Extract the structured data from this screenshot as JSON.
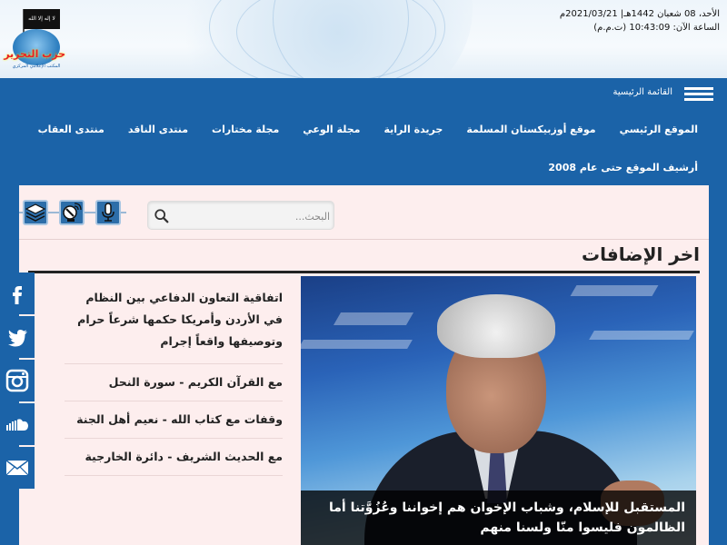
{
  "header": {
    "logo_text": "حزب التحرير",
    "logo_subtext": "المكتب الإعلامي المركزي",
    "logo_flag_text": "لا إله إلا الله محمد رسول الله",
    "date_line": "الأحد، 08 شعبان 1442هـ| 2021/03/21م",
    "time_line": "الساعة الآن: 10:43:09 (ت.م.م)"
  },
  "topbar": {
    "menu_label": "القائمة الرئيسية"
  },
  "nav": {
    "row1": [
      "الموقع الرئيسي",
      "موقع أوزبيكستان المسلمة",
      "جريدة الراية",
      "مجلة الوعي",
      "مجلة مختارات",
      "منتدى الناقد",
      "منتدى العقاب"
    ],
    "row2": [
      "أرشيف الموقع حتى عام 2008"
    ]
  },
  "search": {
    "placeholder": "البحث..."
  },
  "section": {
    "title": "اخر الإضافات"
  },
  "feature": {
    "caption": "المستقبل للإسلام، وشباب الإخوان هم إخواننا وعُزُوَّتنا أما الظالمون فليسوا منّا ولسنا منهم"
  },
  "news": [
    "اتفاقية التعاون الدفاعي بين النظام في الأردن وأمريكا حكمها شرعاً حرام وتوصيفها واقعاً إجرام",
    "مع القرآن الكريم - سورة النحل",
    "وقفات مع كتاب الله - نعيم أهل الجنة",
    "مع الحديث الشريف - دائرة الخارجية"
  ],
  "social": [
    "facebook-icon",
    "twitter-icon",
    "instagram-icon",
    "soundcloud-icon",
    "email-icon"
  ],
  "colors": {
    "primary_blue": "#1b63a8",
    "content_bg": "#fdeeee"
  }
}
